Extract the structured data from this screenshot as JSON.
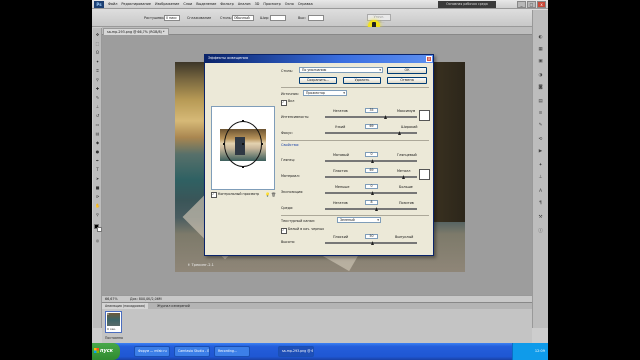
{
  "app": {
    "logo": "Ps",
    "menu": [
      "Файл",
      "Редактирование",
      "Изображение",
      "Слои",
      "Выделение",
      "Фильтр",
      "Анализ",
      "3D",
      "Просмотр",
      "Окно",
      "Справка"
    ],
    "workspace": "Основная рабочая среда",
    "window_controls": [
      "_",
      "□",
      "x"
    ]
  },
  "options_bar": {
    "feather_label": "Растушевка:",
    "feather_value": "0 пикс",
    "smooth_label": "Сглаживание",
    "style_label": "Стиль:",
    "style_value": "Обычный",
    "width_label": "Шир:",
    "height_label": "Выс:",
    "refine_button": "Уточн. край..."
  },
  "document": {
    "tab_label": "sa-mp-293.png @ 66,7% (RGB/8) *",
    "zoom": "66,67%",
    "status": "Док: 800,0K/2,06M",
    "photo_caption": "f: Трекинг-2.1"
  },
  "animation_panel": {
    "tabs": [
      "Анимация (покадровая)",
      "Журнал измерений"
    ],
    "frame_number": "1",
    "frame_duration": "0 сек.",
    "loop": "Постоянно"
  },
  "dialog": {
    "title": "Эффекты освещения",
    "close": "x",
    "style_label": "Стиль:",
    "style_value": "По умолчанию",
    "ok": "ОК",
    "save": "Сохранить...",
    "delete": "Удалить",
    "cancel": "Отмена",
    "light_type_label": "Источник:",
    "light_type_value": "Прожектор",
    "on_label": "Вкл",
    "intensity_label": "Интенсивность:",
    "intensity_min": "Негатив",
    "intensity_max": "Максимум",
    "intensity_value": "35",
    "focus_label": "Фокус:",
    "focus_min": "Узкий",
    "focus_max": "Широкий",
    "focus_value": "69",
    "properties_title": "Свойства:",
    "gloss_label": "Глянец:",
    "gloss_min": "Матовый",
    "gloss_max": "Глянцевый",
    "gloss_value": "0",
    "material_label": "Материал:",
    "material_min": "Пластик",
    "material_max": "Металл",
    "material_value": "69",
    "exposure_label": "Экспозиция:",
    "exposure_min": "Меньше",
    "exposure_max": "Больше",
    "exposure_value": "0",
    "ambience_label": "Среда:",
    "ambience_min": "Негатив",
    "ambience_max": "Позитив",
    "ambience_value": "8",
    "texture_label": "Текстурный канал:",
    "texture_value": "Зеленый",
    "white_high_label": "Белый в кач. черных",
    "height_label": "Высота:",
    "height_min": "Плоский",
    "height_max": "Выпуклый",
    "height_value": "50",
    "preview_label": "Контрольный просмотр",
    "colors": {
      "title_bar": "#0a246a",
      "dialog_bg": "#ece9d8"
    }
  },
  "taskbar": {
    "start": "пуск",
    "tasks": [
      "Форум — mfair.ru",
      "Camtasia Studio - Без...",
      "Recording...",
      "sa-mp-293.png @ 6..."
    ],
    "clock": "12:09"
  }
}
